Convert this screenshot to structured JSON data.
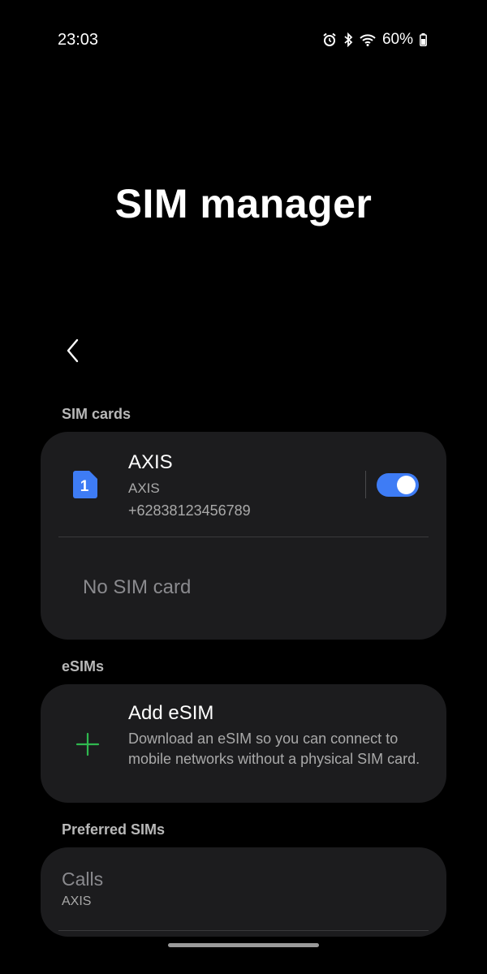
{
  "status_bar": {
    "time": "23:03",
    "battery_percent": "60%",
    "icons": [
      "alarm-icon",
      "bluetooth-icon",
      "wifi-icon",
      "battery-icon"
    ]
  },
  "header": {
    "title": "SIM manager"
  },
  "sections": {
    "sim_cards_label": "SIM cards",
    "esims_label": "eSIMs",
    "preferred_label": "Preferred SIMs"
  },
  "sim1": {
    "slot_number": "1",
    "name": "AXIS",
    "carrier": "AXIS",
    "number": "+62838123456789",
    "enabled": true
  },
  "sim2": {
    "status_text": "No SIM card"
  },
  "esim": {
    "title": "Add eSIM",
    "description": "Download an eSIM so you can connect to mobile networks without a physical SIM card."
  },
  "preferred": {
    "calls_label": "Calls",
    "calls_value": "AXIS"
  },
  "colors": {
    "accent": "#3e7cf5",
    "add_icon": "#2fb84f",
    "card_bg": "#1c1c1e"
  }
}
